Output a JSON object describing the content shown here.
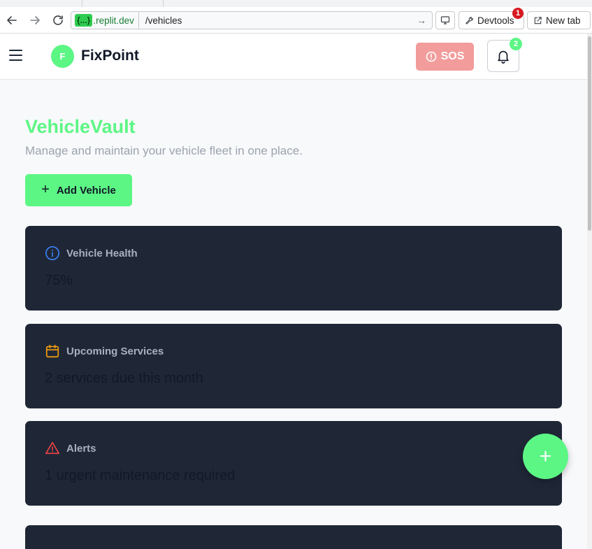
{
  "browser": {
    "url_host_badge": "{...}",
    "url_host": ".replit.dev",
    "url_path": "/vehicles",
    "devtools_label": "Devtools",
    "devtools_badge": "1",
    "newtab_label": "New tab"
  },
  "header": {
    "logo_letter": "F",
    "brand": "FixPoint",
    "sos_label": "SOS",
    "notification_count": "2"
  },
  "main": {
    "title": "VehicleVault",
    "subtitle": "Manage and maintain your vehicle fleet in one place.",
    "add_button_label": "Add Vehicle",
    "cards": [
      {
        "icon": "info-icon",
        "label": "Vehicle Health",
        "value": "75%"
      },
      {
        "icon": "calendar-icon",
        "label": "Upcoming Services",
        "value": "2 services due this month"
      },
      {
        "icon": "warning-icon",
        "label": "Alerts",
        "value": "1 urgent maintenance required"
      }
    ]
  },
  "fab_label": "+",
  "colors": {
    "accent": "#5cf685",
    "card_bg": "#1f2737",
    "sos": "#f29c9c",
    "info": "#3b82f6",
    "calendar": "#f59e0b",
    "alert": "#ef4444"
  }
}
